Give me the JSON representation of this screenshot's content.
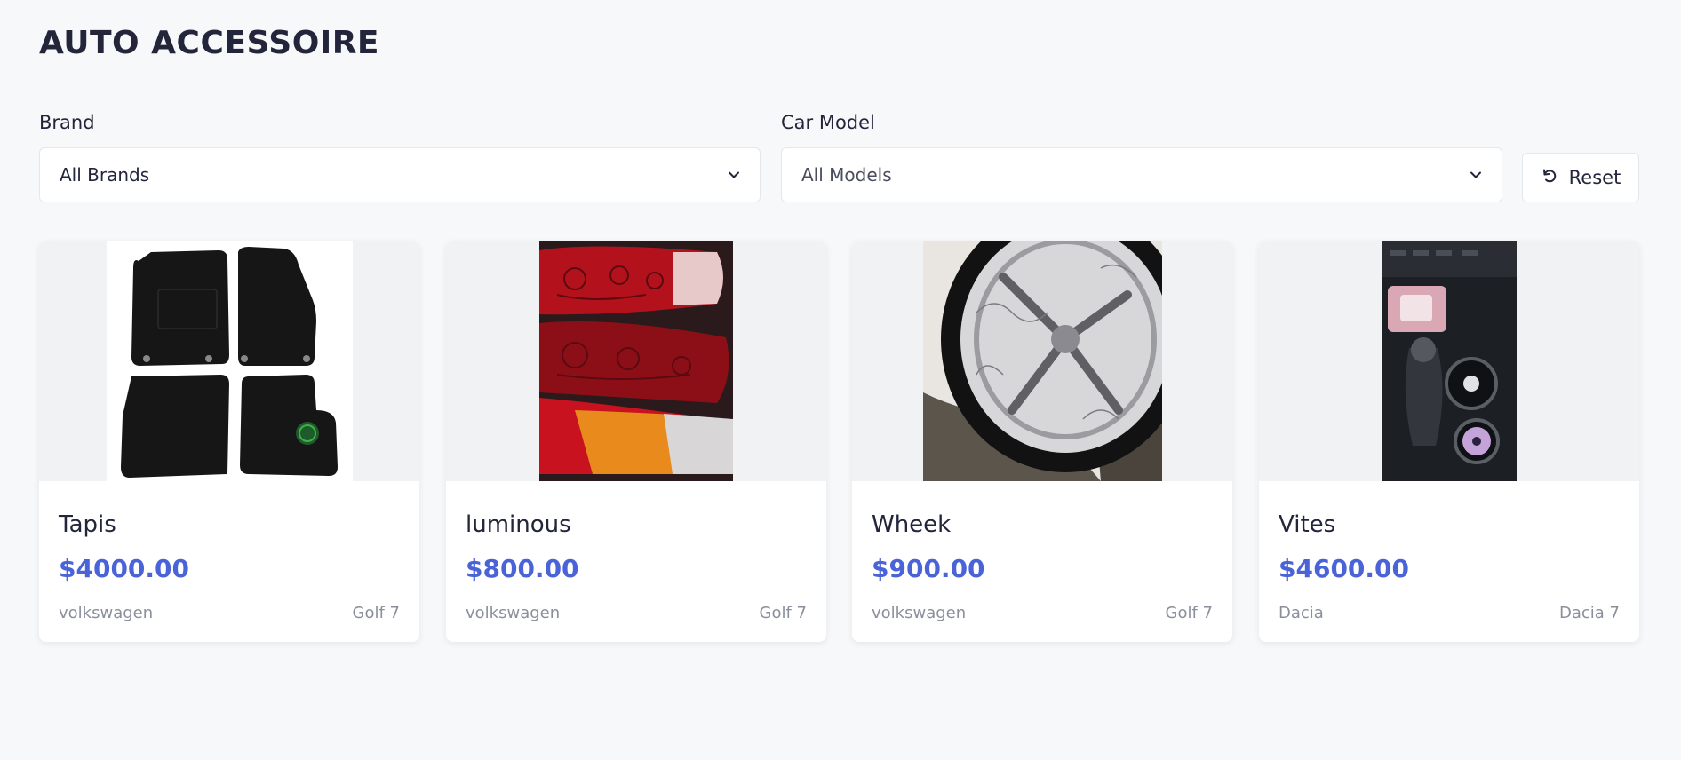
{
  "header": {
    "title": "AUTO ACCESSOIRE"
  },
  "filters": {
    "brand_label": "Brand",
    "brand_value": "All Brands",
    "model_label": "Car Model",
    "model_value": "All Models",
    "reset_label": "Reset"
  },
  "products": [
    {
      "name": "Tapis",
      "price": "$4000.00",
      "brand": "volkswagen",
      "model": "Golf 7",
      "image": "car-floor-mats"
    },
    {
      "name": "luminous",
      "price": "$800.00",
      "brand": "volkswagen",
      "model": "Golf 7",
      "image": "engraved-tail-lights"
    },
    {
      "name": "Wheek",
      "price": "$900.00",
      "brand": "volkswagen",
      "model": "Golf 7",
      "image": "engraved-chrome-wheel"
    },
    {
      "name": "Vites",
      "price": "$4600.00",
      "brand": "Dacia",
      "model": "Dacia 7",
      "image": "gear-console-interior"
    }
  ],
  "colors": {
    "accent": "#4a63d6",
    "background": "#f7f8fa",
    "text": "#23263a",
    "muted": "#8a8f9c"
  }
}
